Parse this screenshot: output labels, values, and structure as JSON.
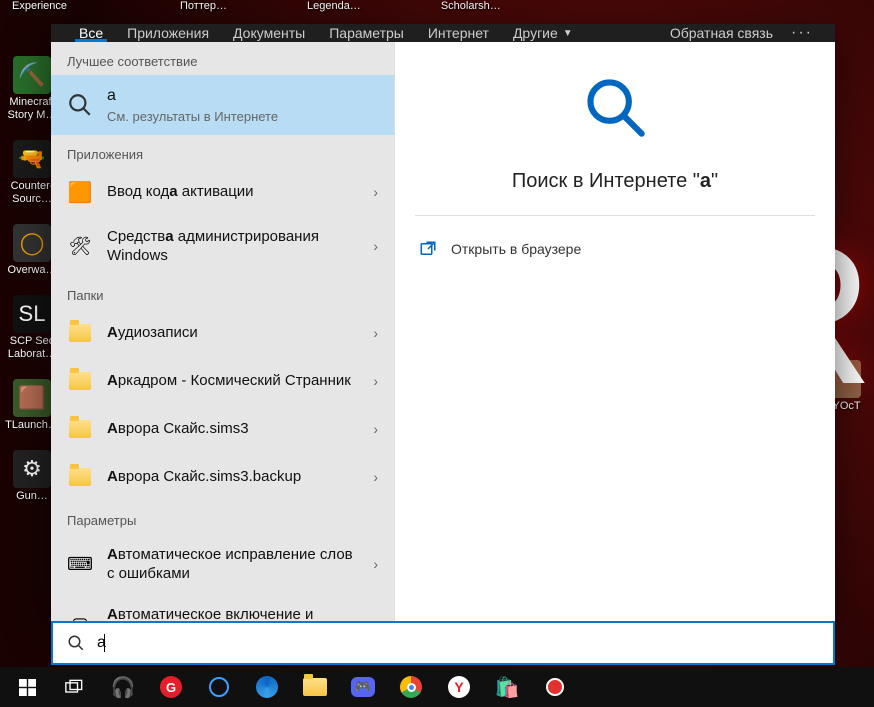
{
  "desktop": {
    "left_icons": [
      {
        "label": "Experience"
      },
      {
        "label": "Minecraft Story M…"
      },
      {
        "label": "Counter-Sourc…"
      },
      {
        "label": "Overwa…"
      },
      {
        "label": "SCP Sec Laborat…"
      },
      {
        "label": "TLaunch…"
      },
      {
        "label": "Gun…"
      }
    ],
    "top_labels": [
      "Поттер…",
      "Legenda…",
      "Scholarsh…"
    ],
    "right_icons": [
      {
        "label": "atYOcT"
      }
    ],
    "big_letter": "R"
  },
  "search_panel": {
    "tabs": [
      "Все",
      "Приложения",
      "Документы",
      "Параметры",
      "Интернет"
    ],
    "other_tab": "Другие",
    "feedback": "Обратная связь",
    "sections": {
      "best_match": {
        "label": "Лучшее соответствие",
        "item": {
          "title": "a",
          "sub": "См. результаты в Интернете"
        }
      },
      "apps": {
        "label": "Приложения",
        "items": [
          {
            "prefix": "",
            "bold": "",
            "suffix": "Ввод кода активации"
          },
          {
            "prefix": "Средств",
            "bold": "а",
            "suffix": " администрирования Windows"
          }
        ]
      },
      "folders": {
        "label": "Папки",
        "items": [
          {
            "prefix": "",
            "bold": "А",
            "suffix": "удиозаписи"
          },
          {
            "prefix": "",
            "bold": "А",
            "suffix": "ркадром - Космический Странник"
          },
          {
            "prefix": "",
            "bold": "А",
            "suffix": "врора Скайс.sims3"
          },
          {
            "prefix": "",
            "bold": "А",
            "suffix": "врора Скайс.sims3.backup"
          }
        ]
      },
      "settings": {
        "label": "Параметры",
        "items": [
          {
            "prefix": "",
            "bold": "А",
            "suffix": "втоматическое исправление слов с ошибками"
          },
          {
            "prefix": "",
            "bold": "А",
            "suffix": "втоматическое включение и выключение режима планшета"
          }
        ]
      }
    },
    "preview": {
      "title_prefix": "Поиск в Интернете \"",
      "title_query": "a",
      "title_suffix": "\"",
      "open_browser": "Открыть в браузере"
    },
    "search_input": {
      "value": "a"
    }
  },
  "taskbar": {
    "items": [
      "start",
      "task-view",
      "audio",
      "otu",
      "cortana",
      "edge",
      "explorer",
      "discord",
      "chrome",
      "yandex",
      "store",
      "record"
    ]
  }
}
